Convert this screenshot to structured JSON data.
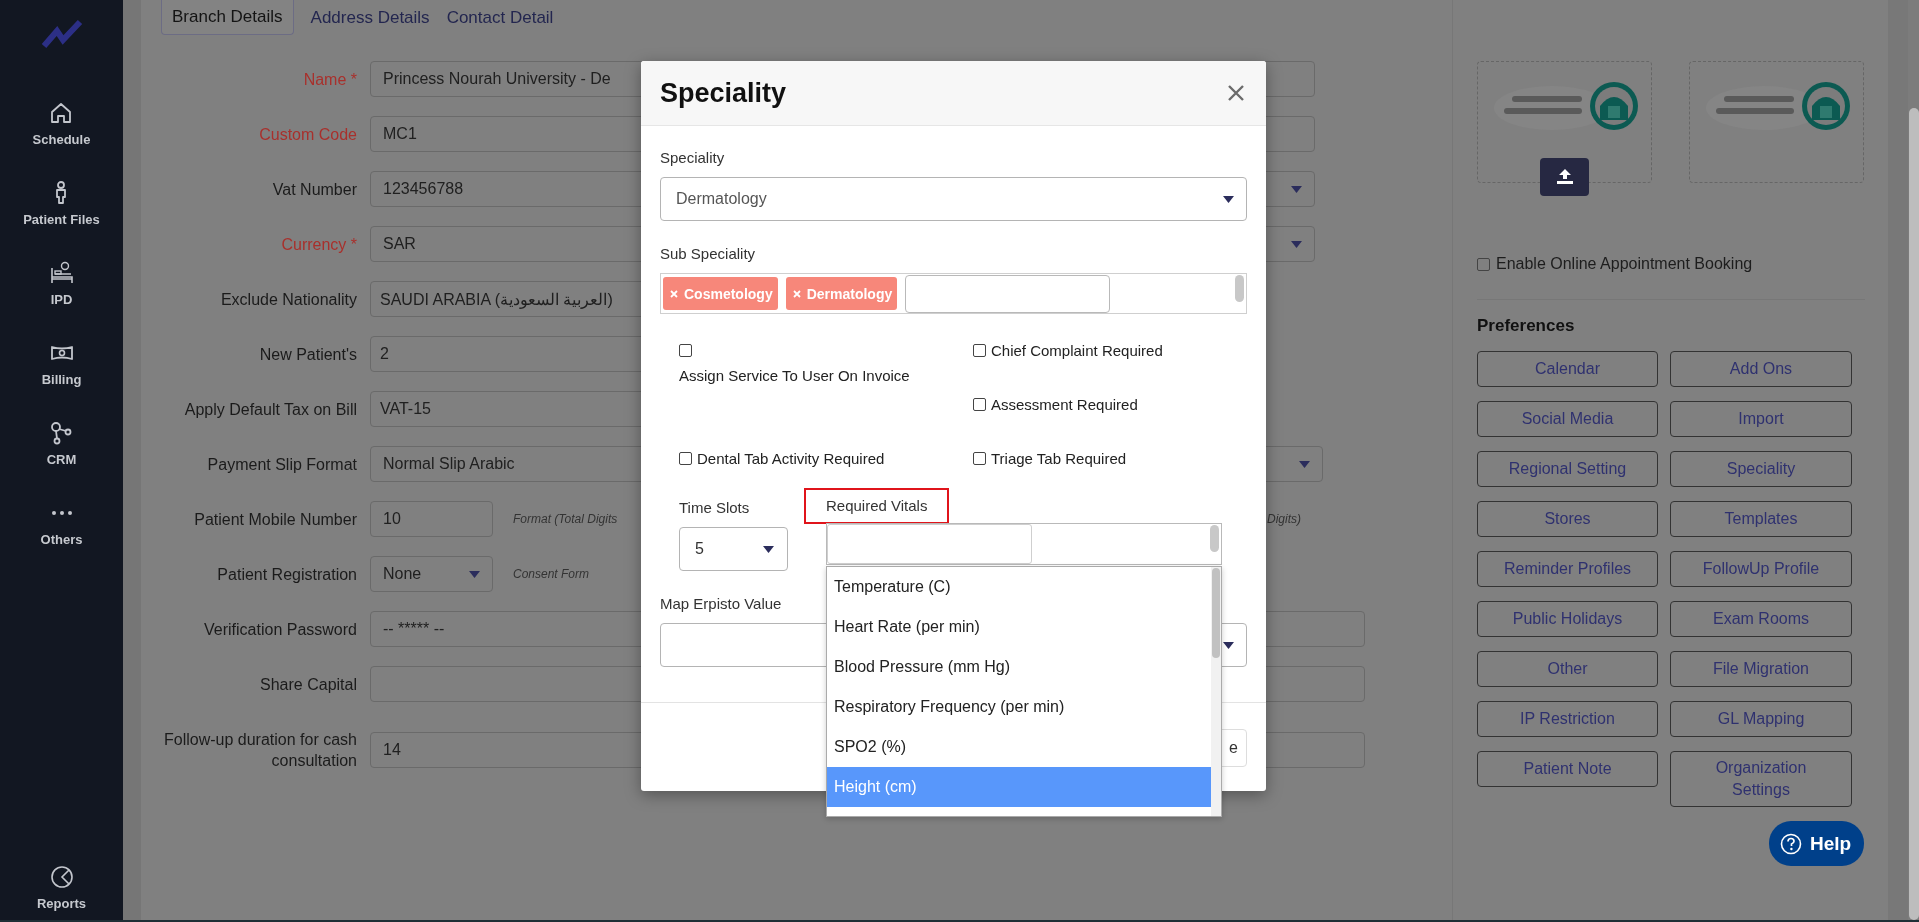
{
  "sidebar": {
    "items": [
      {
        "label": "Schedule",
        "kind": "home"
      },
      {
        "label": "Patient Files",
        "kind": "person"
      },
      {
        "label": "IPD",
        "kind": "bed"
      },
      {
        "label": "Billing",
        "kind": "money"
      },
      {
        "label": "CRM",
        "kind": "network"
      },
      {
        "label": "Others",
        "kind": "more"
      },
      {
        "label": "Reports",
        "kind": "report"
      }
    ]
  },
  "tabs": [
    {
      "label": "Branch Details",
      "selected": true
    },
    {
      "label": "Address Details",
      "selected": false
    },
    {
      "label": "Contact Detail",
      "selected": false
    }
  ],
  "form": {
    "rows": [
      {
        "label": "Name *",
        "required": true,
        "kind": "text",
        "value": "Princess Nourah University - De"
      },
      {
        "label": "Custom Code",
        "required": true,
        "kind": "text",
        "value": "MC1"
      },
      {
        "label": "Vat Number",
        "required": false,
        "kind": "select",
        "value": "123456788"
      },
      {
        "label": "Currency *",
        "required": true,
        "kind": "select",
        "value": "SAR"
      },
      {
        "label": "Exclude Nationality",
        "required": false,
        "kind": "text",
        "value": "SAUDI ARABIA (العربية السعودية)"
      },
      {
        "label": "New Patient's",
        "required": false,
        "kind": "text",
        "value": "2"
      },
      {
        "label": "Apply Default Tax on Bill",
        "required": false,
        "kind": "text",
        "value": "VAT-15"
      },
      {
        "label": "Payment Slip Format",
        "required": false,
        "kind": "select",
        "value": "Normal Slip Arabic"
      },
      {
        "label": "Patient Mobile Number",
        "required": false,
        "kind": "text",
        "value": "10",
        "hint": "Format (Total Digits",
        "hint_end": "Digits)"
      },
      {
        "label": "Patient Registration",
        "required": false,
        "kind": "select",
        "value": "None",
        "hint": "Consent Form"
      },
      {
        "label": "Verification Password",
        "required": false,
        "kind": "text",
        "value": "-- ***** --"
      },
      {
        "label": "Share Capital",
        "required": false,
        "kind": "text"
      },
      {
        "label": "Follow-up duration for cash consultation",
        "required": false,
        "kind": "text",
        "value": "14"
      }
    ]
  },
  "modal": {
    "title": "Speciality",
    "speciality": {
      "label": "Speciality",
      "value": "Dermatology"
    },
    "sub_speciality": {
      "label": "Sub Speciality",
      "tags": [
        "Cosmetology",
        "Dermatology"
      ]
    },
    "options": [
      {
        "label": "Assign Service To User On Invoice",
        "checked": false
      },
      {
        "label": "Chief Complaint Required",
        "checked": false
      },
      {
        "label": "Assessment Required",
        "checked": false
      },
      {
        "label": "Dental Tab Activity Required",
        "checked": false
      },
      {
        "label": "Triage Tab Required",
        "checked": false
      }
    ],
    "time_slots": {
      "label": "Time Slots",
      "value": "5"
    },
    "required_vitals": {
      "label": "Required Vitals",
      "highlighted": true,
      "options": [
        {
          "label": "Temperature (C)",
          "selected": false
        },
        {
          "label": "Heart Rate (per min)",
          "selected": false
        },
        {
          "label": "Blood Pressure (mm Hg)",
          "selected": false
        },
        {
          "label": "Respiratory Frequency (per min)",
          "selected": false
        },
        {
          "label": "SPO2 (%)",
          "selected": false
        },
        {
          "label": "Height (cm)",
          "selected": true
        }
      ]
    },
    "map_erpisto": {
      "label": "Map Erpisto Value"
    },
    "footer_button": "e"
  },
  "logos": [
    {
      "kind": "picture",
      "upload": true
    },
    {
      "kind": "picture",
      "upload": false
    }
  ],
  "online_booking": {
    "label": "Enable Online Appointment Booking",
    "checked": false
  },
  "preferences": {
    "title": "Preferences",
    "buttons": [
      "Calendar",
      "Add Ons",
      "Social Media",
      "Import",
      "Regional Setting",
      "Speciality",
      "Stores",
      "Templates",
      "Reminder Profiles",
      "FollowUp Profile",
      "Public Holidays",
      "Exam Rooms",
      "Other",
      "File Migration",
      "IP Restriction",
      "GL Mapping",
      "Patient Note",
      "Organization Settings"
    ]
  },
  "help": {
    "label": "Help"
  }
}
